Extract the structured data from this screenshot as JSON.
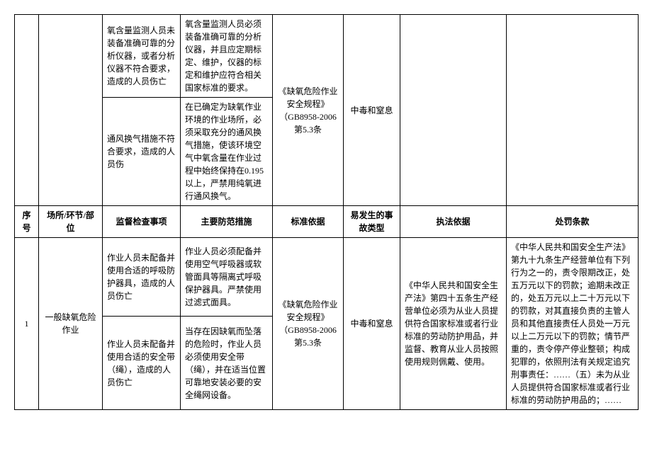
{
  "top_rows": [
    {
      "col3": "氧含量监测人员未装备准确可靠的分析仪器，或者分析仪器不符合要求，造成的人员伤亡",
      "col4": "氧含量监测人员必须装备准确可靠的分析仪器，并且应定期标定、维护，仪器的标定和维护应符合相关国家标准的要求。",
      "col5": "《缺氧危险作业安全规程》（GB8958-2006 第5.3条",
      "col6": "中毒和窒息"
    },
    {
      "col3": "通风换气措施不符合要求，造成的人员伤",
      "col4": "在已确定为缺氧作业环境的作业场所，必须采取充分的通风换气措施，使该环境空气中氧含量在作业过程中始终保持在0.195以上，严禁用纯氧进行通风换气。"
    }
  ],
  "headers": {
    "c1": "序号",
    "c2": "场所/环节/部位",
    "c3": "监督检查事项",
    "c4": "主要防范措施",
    "c5": "标准依据",
    "c6": "易发生的事故类型",
    "c7": "执法依据",
    "c8": "处罚条款"
  },
  "rows": [
    {
      "c1": "1",
      "c2": "一般缺氧危险作业",
      "sub": [
        {
          "c3": "作业人员未配备并使用合适的呼吸防护器具，造成的人员伤亡",
          "c4": "作业人员必须配备并使用空气呼吸器或软管面具等隔离式呼吸保护器具。严禁使用过滤式面具。"
        },
        {
          "c3": "作业人员未配备并使用合适的安全带\n（绳），造成的人员伤亡",
          "c4": "当存在因缺氧而坠落的危险时，作业人员必须使用安全带（绳），并在适当位置可靠地安装必要的安全绳网设备。"
        }
      ],
      "c5": "《缺氧危险作业安全规程》（GB8958-2006 第5.3条",
      "c6": "中毒和窒息",
      "c7": "《中华人民共和国安全生产法》第四十五条生产经营单位必须为从业人员提供符合国家标准或者行业标准的劳动防护用品，并监督、教育从业人员按照使用规则佩戴、使用。",
      "c8": "《中华人民共和国安全生产法》第九十九条生产经营单位有下列行为之一的，责令限期改正，处五万元以下的罚款；逾期未改正的，处五万元以上二十万元以下的罚款，对其直接负责的主管人员和其他直接责任人员处一万元以上二万元以下的罚款；情节严重的，责令停产停业整顿；构成犯罪的，依照刑法有关规定追究刑事责任：……（五）未为从业人员提供符合国家标准或者行业标准的劳动防护用品的；……"
    }
  ]
}
